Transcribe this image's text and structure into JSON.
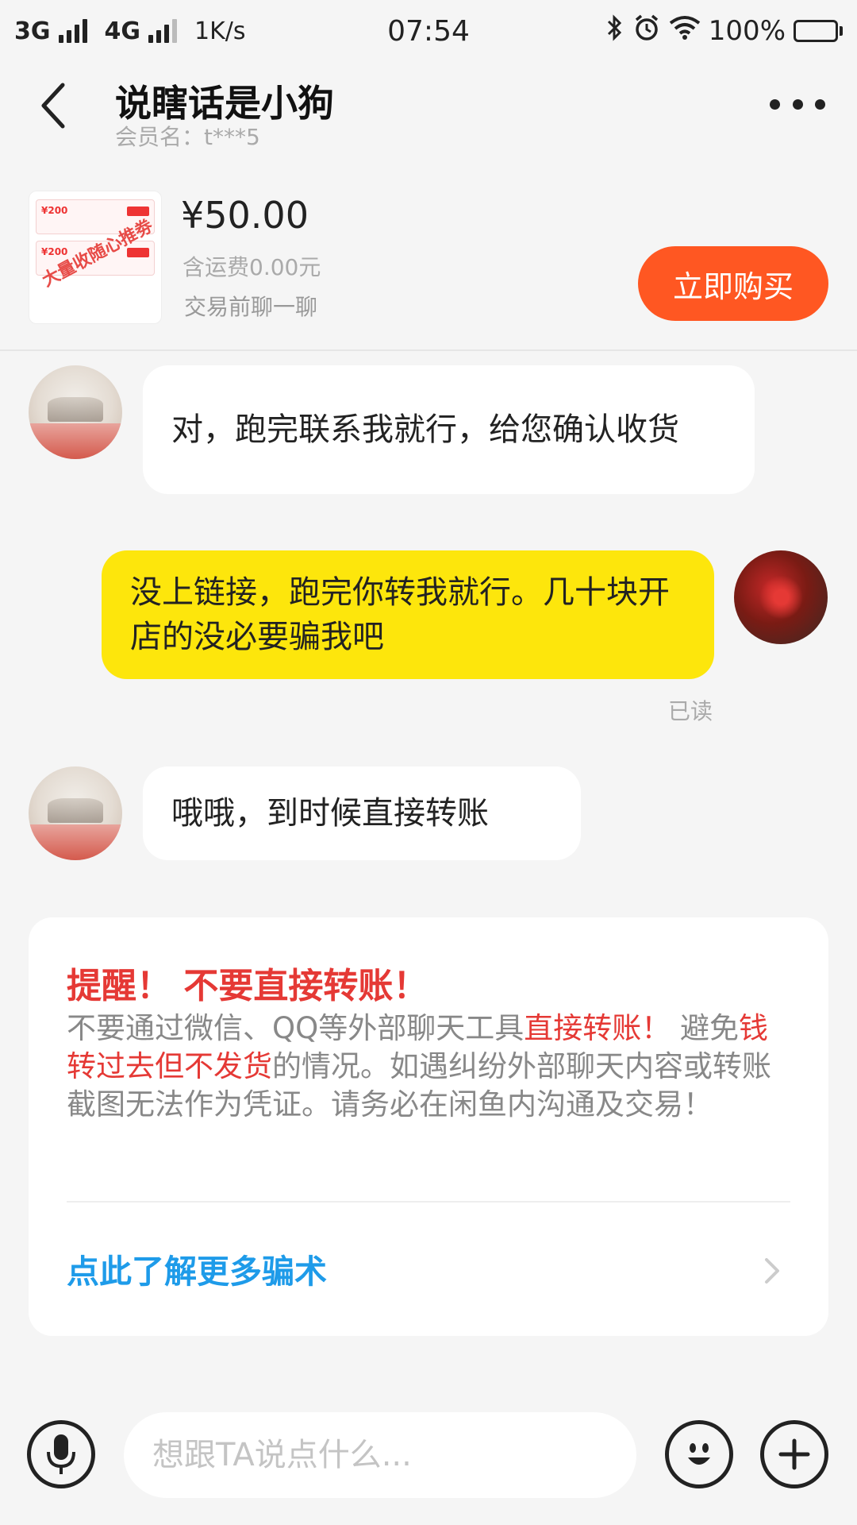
{
  "status_bar": {
    "net1": "3G",
    "net2": "4G",
    "speed": "1K/s",
    "time": "07:54",
    "battery": "100%"
  },
  "header": {
    "title": "说瞎话是小狗",
    "member": "会员名：t***5"
  },
  "product": {
    "thumb_stamp": "大量收随心推劵",
    "thumb_amount": "¥200",
    "price": "¥50.00",
    "shipping": "含运费0.00元",
    "chat_hint": "交易前聊一聊",
    "buy_label": "立即购买"
  },
  "messages": [
    {
      "from": "other",
      "text": "对，跑完联系我就行，给您确认收货"
    },
    {
      "from": "me",
      "text": "没上链接，跑完你转我就行。几十块开店的没必要骗我吧",
      "status": "已读"
    },
    {
      "from": "other",
      "text": "哦哦，到时候直接转账"
    }
  ],
  "warning": {
    "title": "提醒！ 不要直接转账！",
    "body_1": "不要通过微信、QQ等外部聊天工具",
    "body_hl_1": "直接转账！",
    "body_2": "避免",
    "body_hl_2": "钱转过去但不发货",
    "body_3": "的情况。如遇纠纷外部聊天内容或转账截图无法作为凭证。请务必在闲鱼内沟通及交易！",
    "link": "点此了解更多骗术"
  },
  "input": {
    "placeholder": "想跟TA说点什么..."
  },
  "colors": {
    "accent": "#ff5722",
    "my_bubble": "#fde60c",
    "warning_red": "#e53935",
    "link_blue": "#1e9be9"
  },
  "icons": [
    "back-arrow-icon",
    "more-icon",
    "bluetooth-icon",
    "alarm-icon",
    "wifi-icon",
    "battery-icon",
    "microphone-icon",
    "emoji-icon",
    "plus-icon",
    "chevron-right-icon"
  ]
}
